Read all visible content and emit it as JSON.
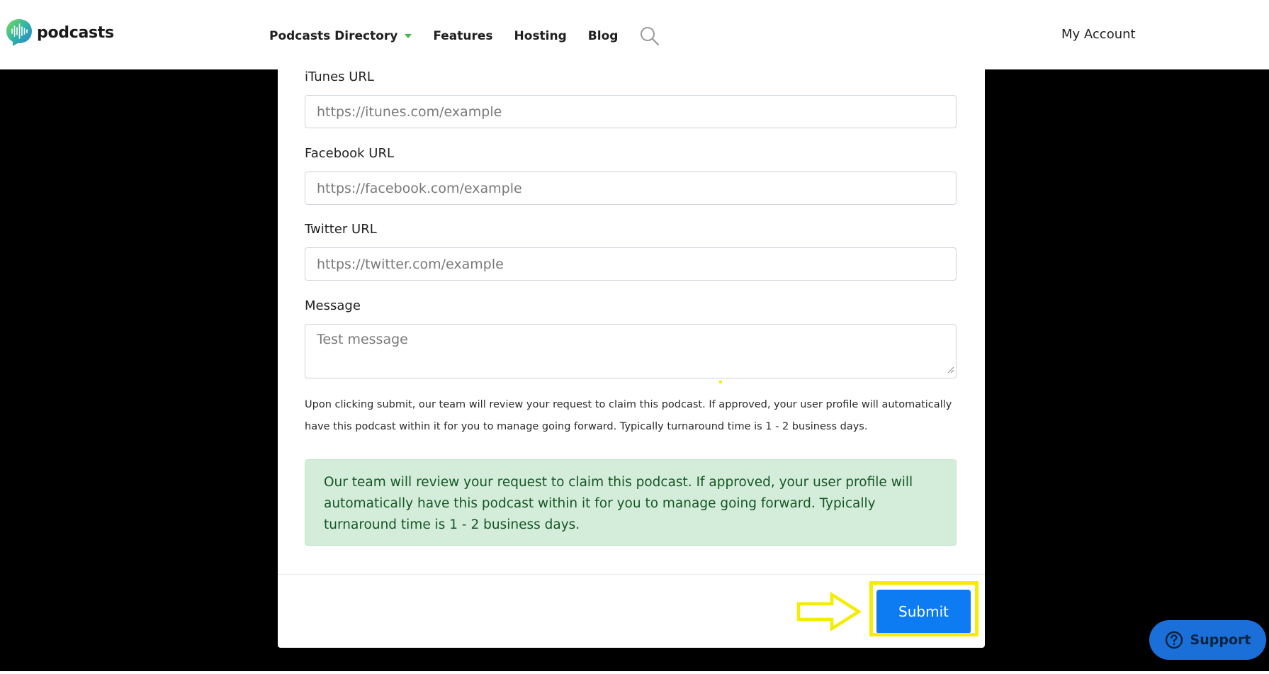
{
  "header": {
    "logo_text": "podcasts",
    "nav": [
      {
        "label": "Podcasts Directory"
      },
      {
        "label": "Features"
      },
      {
        "label": "Hosting"
      },
      {
        "label": "Blog"
      }
    ],
    "account_label": "My Account"
  },
  "form": {
    "itunes": {
      "label": "iTunes URL",
      "placeholder": "https://itunes.com/example"
    },
    "facebook": {
      "label": "Facebook URL",
      "placeholder": "https://facebook.com/example"
    },
    "twitter": {
      "label": "Twitter URL",
      "placeholder": "https://twitter.com/example"
    },
    "message": {
      "label": "Message",
      "placeholder": "Test message"
    },
    "help_text": "Upon clicking submit, our team will review your request to claim this podcast. If approved, your user profile will automatically have this podcast within it for you to manage going forward. Typically turnaround time is 1 - 2 business days.",
    "success_message": "Our team will review your request to claim this podcast. If approved, your user profile will automatically have this podcast within it for you to manage going forward. Typically turnaround time is 1 - 2 business days.",
    "submit_label": "Submit"
  },
  "support": {
    "label": "Support"
  },
  "colors": {
    "primary": "#0d7bf2",
    "success_bg": "#d4edda",
    "success_text": "#155724",
    "annotation": "#f5ec00",
    "accent_green": "#45b649"
  }
}
